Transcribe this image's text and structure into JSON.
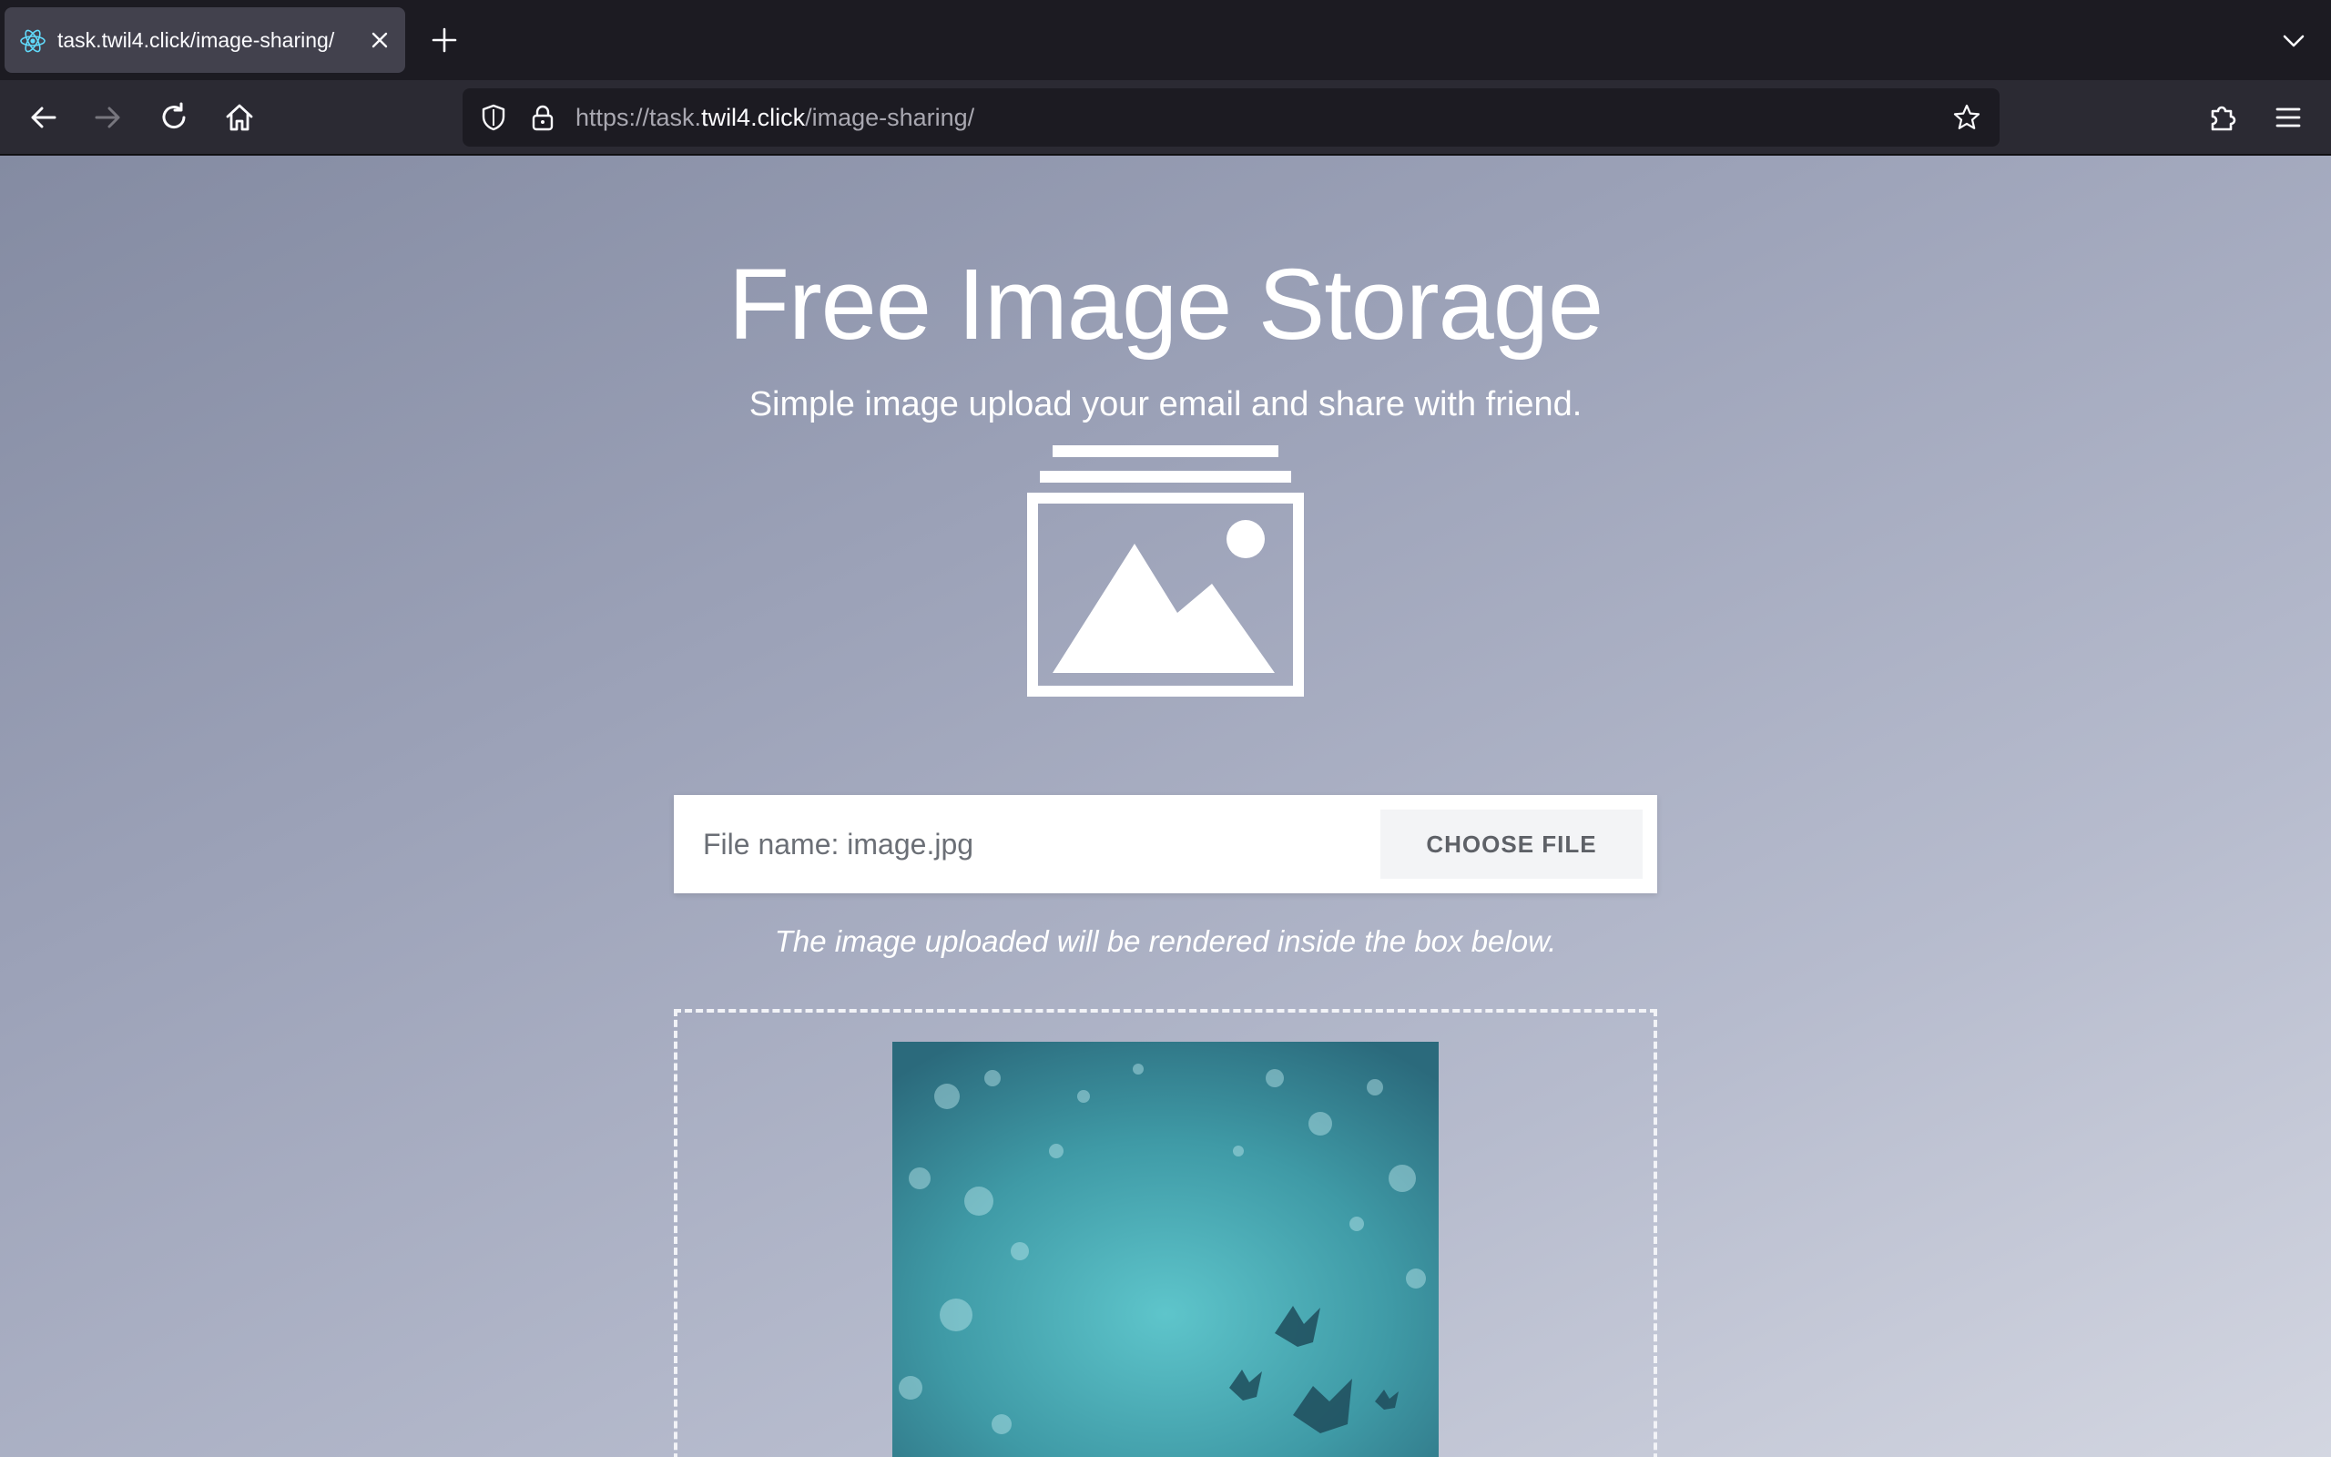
{
  "browser": {
    "tab_title": "task.twil4.click/image-sharing/",
    "url_prefix": "https://task.",
    "url_host": "twil4.click",
    "url_path": "/image-sharing/",
    "icons": [
      "react-favicon-icon",
      "close-icon",
      "plus-icon",
      "chevron-down-icon",
      "back-arrow-icon",
      "forward-arrow-icon",
      "reload-icon",
      "home-icon",
      "shield-icon",
      "lock-icon",
      "star-icon",
      "extensions-icon",
      "menu-icon"
    ]
  },
  "page": {
    "title": "Free Image Storage",
    "subtitle": "Simple image upload your email and share with friend.",
    "file_name_text": "File name: image.jpg",
    "choose_file_label": "CHOOSE FILE",
    "hint": "The image uploaded will be rendered inside the box below."
  },
  "colors": {
    "page_gradient_start": "#848ba2",
    "page_gradient_end": "#d3d6e1",
    "preview_teal": "#4fb3bb"
  }
}
